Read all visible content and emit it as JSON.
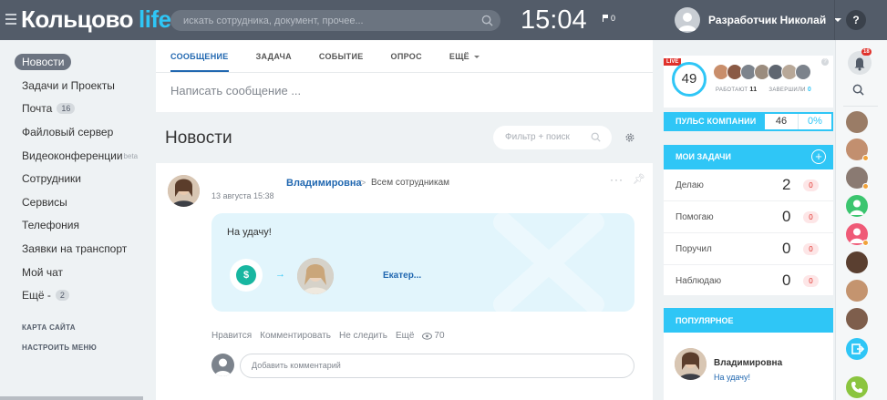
{
  "header": {
    "logo_main": "Кольцово",
    "logo_accent": "life",
    "search_placeholder": "искать сотрудника, документ, прочее...",
    "clock": "15:04",
    "flag_count": "0",
    "user_name": "Разработчик Николай",
    "help": "?"
  },
  "leftmenu": {
    "items": [
      {
        "label": "Новости"
      },
      {
        "label": "Задачи и Проекты"
      },
      {
        "label": "Почта",
        "counter": "16"
      },
      {
        "label": "Файловый сервер"
      },
      {
        "label": "Видеоконференции",
        "sup": "beta"
      },
      {
        "label": "Сотрудники"
      },
      {
        "label": "Сервисы"
      },
      {
        "label": "Телефония"
      },
      {
        "label": "Заявки на транспорт"
      },
      {
        "label": "Мой чат"
      },
      {
        "label": "Ещё -",
        "counter": "2"
      }
    ],
    "sitemap": "КАРТА САЙТА",
    "setup": "НАСТРОИТЬ МЕНЮ"
  },
  "composer": {
    "tabs": [
      "СООБЩЕНИЕ",
      "ЗАДАЧА",
      "СОБЫТИЕ",
      "ОПРОС",
      "ЕЩЁ"
    ],
    "placeholder": "Написать сообщение ..."
  },
  "feed": {
    "title": "Новости",
    "filter_placeholder": "Фильтр + поиск"
  },
  "post": {
    "author": "Владимировна",
    "arrow": ">",
    "destination": "Всем сотрудникам",
    "date": "13 августа 15:38",
    "text": "На удачу!",
    "recipient": "Екатер...",
    "actions": [
      "Нравится",
      "Комментировать",
      "Не следить",
      "Ещё"
    ],
    "views": "70",
    "comment_placeholder": "Добавить комментарий"
  },
  "live": {
    "tag": "LIVE",
    "count": "49",
    "working_label": "РАБОТАЮТ",
    "working_count": "11",
    "finished_label": "ЗАВЕРШИЛИ",
    "finished_count": "0"
  },
  "pulse": {
    "label": "ПУЛЬС КОМПАНИИ",
    "value": "46",
    "percent": "0%"
  },
  "tasks": {
    "title": "МОИ ЗАДАЧИ",
    "rows": [
      {
        "label": "Делаю",
        "value": "2",
        "badge": "0"
      },
      {
        "label": "Помогаю",
        "value": "0",
        "badge": "0"
      },
      {
        "label": "Поручил",
        "value": "0",
        "badge": "0"
      },
      {
        "label": "Наблюдаю",
        "value": "0",
        "badge": "0"
      }
    ]
  },
  "popular": {
    "title": "ПОПУЛЯРНОЕ",
    "name": "Владимировна",
    "text": "На удачу!"
  },
  "rstrip": {
    "notif_count": "18"
  },
  "colors": {
    "header_bg": "#535c69",
    "accent": "#2fc6f6",
    "link": "#2067b0"
  }
}
